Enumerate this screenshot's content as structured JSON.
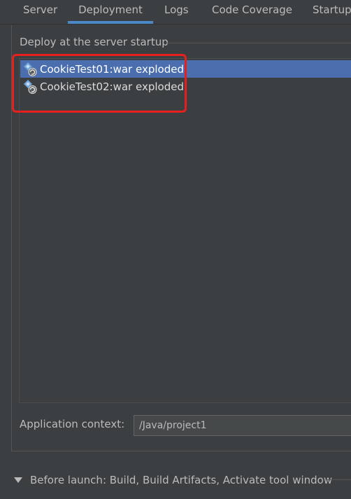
{
  "tabs": [
    {
      "label": "Server"
    },
    {
      "label": "Deployment"
    },
    {
      "label": "Logs"
    },
    {
      "label": "Code Coverage"
    },
    {
      "label": "Startup"
    }
  ],
  "active_tab": "Deployment",
  "deploy_group": {
    "title": "Deploy at the server startup",
    "artifacts": [
      {
        "label": "CookieTest01:war exploded",
        "icon": "artifact-war-exploded-icon",
        "selected": true
      },
      {
        "label": "CookieTest02:war exploded",
        "icon": "artifact-war-exploded-icon",
        "selected": false
      }
    ]
  },
  "app_context": {
    "label": "Application context:",
    "value": "/Java/project1"
  },
  "before_launch": {
    "text": "Before launch: Build, Build Artifacts, Activate tool window",
    "icon": "triangle-down-icon"
  },
  "colors": {
    "background": "#3c3f41",
    "selection": "#4b6eaf",
    "highlight": "#e8201d",
    "tab_underline": "#4a88c7"
  }
}
